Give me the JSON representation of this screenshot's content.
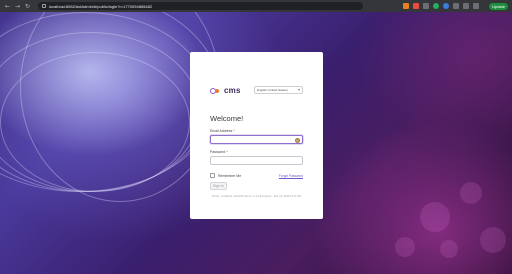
{
  "browser": {
    "back_icon": "back-arrow-icon",
    "forward_icon": "forward-arrow-icon",
    "reload_icon": "reload-icon",
    "url": "localhost:8082/dotAdmin/#/public/login?r=1770094865482",
    "update_label": "Update"
  },
  "login": {
    "brand": "cms",
    "language_value": "English (United States)",
    "welcome": "Welcome!",
    "email_label": "Email Address",
    "required_mark": "*",
    "email_value": "",
    "password_label": "Password",
    "password_value": "",
    "remember_label": "Remember Me",
    "forgot_link": "Forgot Password",
    "signin_label": "Sign In",
    "footer_text": "Server: Localhost | dotCMS Server: 2.3.2 Evergreen - Mar 16, 2026 12:31 PM"
  },
  "colors": {
    "accent": "#8e6fd0",
    "brand_purple": "#8a5cc8",
    "brand_orange": "#e57b3a",
    "update_green": "#1e8e3e"
  }
}
